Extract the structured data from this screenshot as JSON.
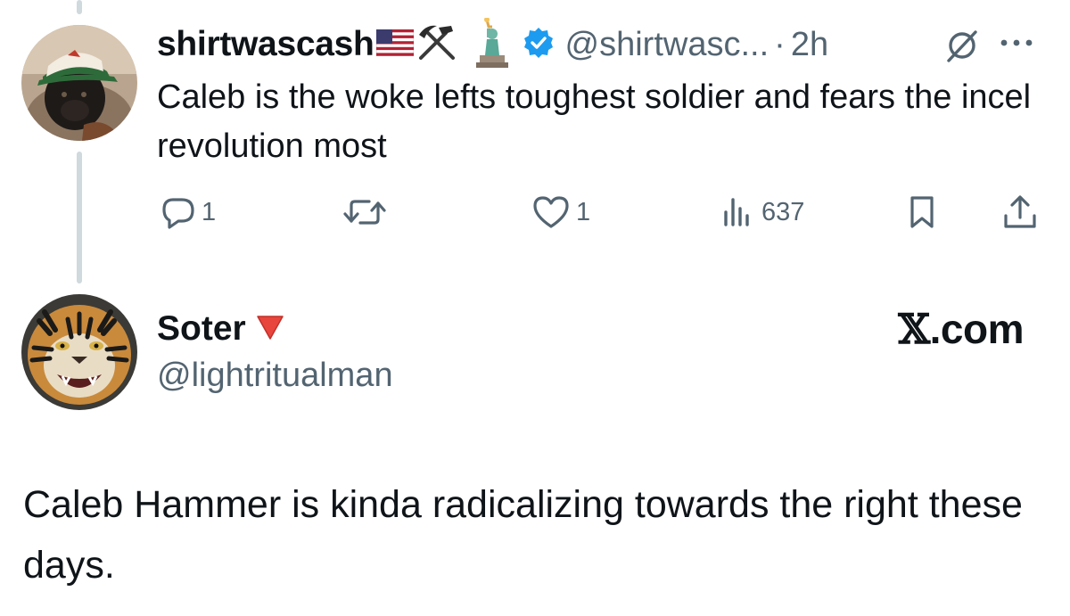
{
  "tweet": {
    "display_name": "shirtwascash",
    "name_emojis": [
      "us-flag-icon",
      "hammer-and-pick-icon",
      "statue-of-liberty-icon"
    ],
    "verified": true,
    "handle": "@shirtwasc...",
    "separator": "·",
    "time": "2h",
    "text": "Caleb is the woke lefts toughest soldier and fears the incel revolution most",
    "actions": {
      "replies": "1",
      "reposts": "",
      "likes": "1",
      "views": "637"
    },
    "accent_color": "#1d9bf0",
    "muted_color": "#536471"
  },
  "quoted": {
    "display_name": "Soter",
    "name_emoji": "red-triangle-down-icon",
    "handle": "@lightritualman",
    "watermark_x": "𝕏",
    "watermark_rest": ".com",
    "text": "Caleb Hammer is kinda radicalizing towards the right these days."
  }
}
